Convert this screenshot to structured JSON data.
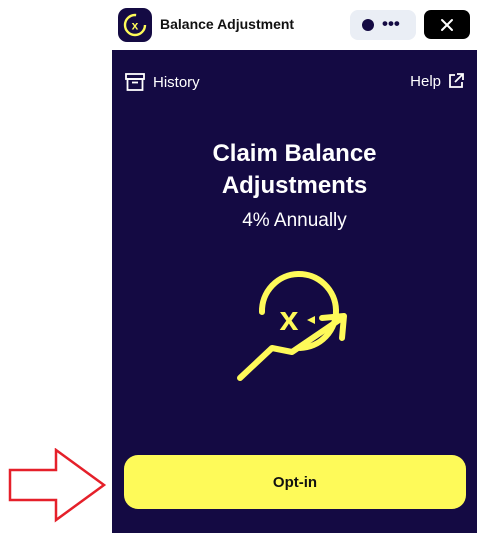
{
  "header": {
    "app_title": "Balance Adjustment",
    "menu_label": "•••",
    "close_label": "✕"
  },
  "toolbar": {
    "history_label": "History",
    "help_label": "Help"
  },
  "content": {
    "headline_line1": "Claim Balance",
    "headline_line2": "Adjustments",
    "rate": "4% Annually"
  },
  "actions": {
    "optin_label": "Opt-in"
  },
  "colors": {
    "panel_bg": "#140a43",
    "accent": "#fefa59",
    "annotation_arrow": "#e5202a"
  },
  "icons": [
    "app-logo-icon",
    "status-dot-icon",
    "close-icon",
    "history-icon",
    "external-link-icon",
    "growth-chart-icon",
    "annotation-arrow-icon"
  ]
}
